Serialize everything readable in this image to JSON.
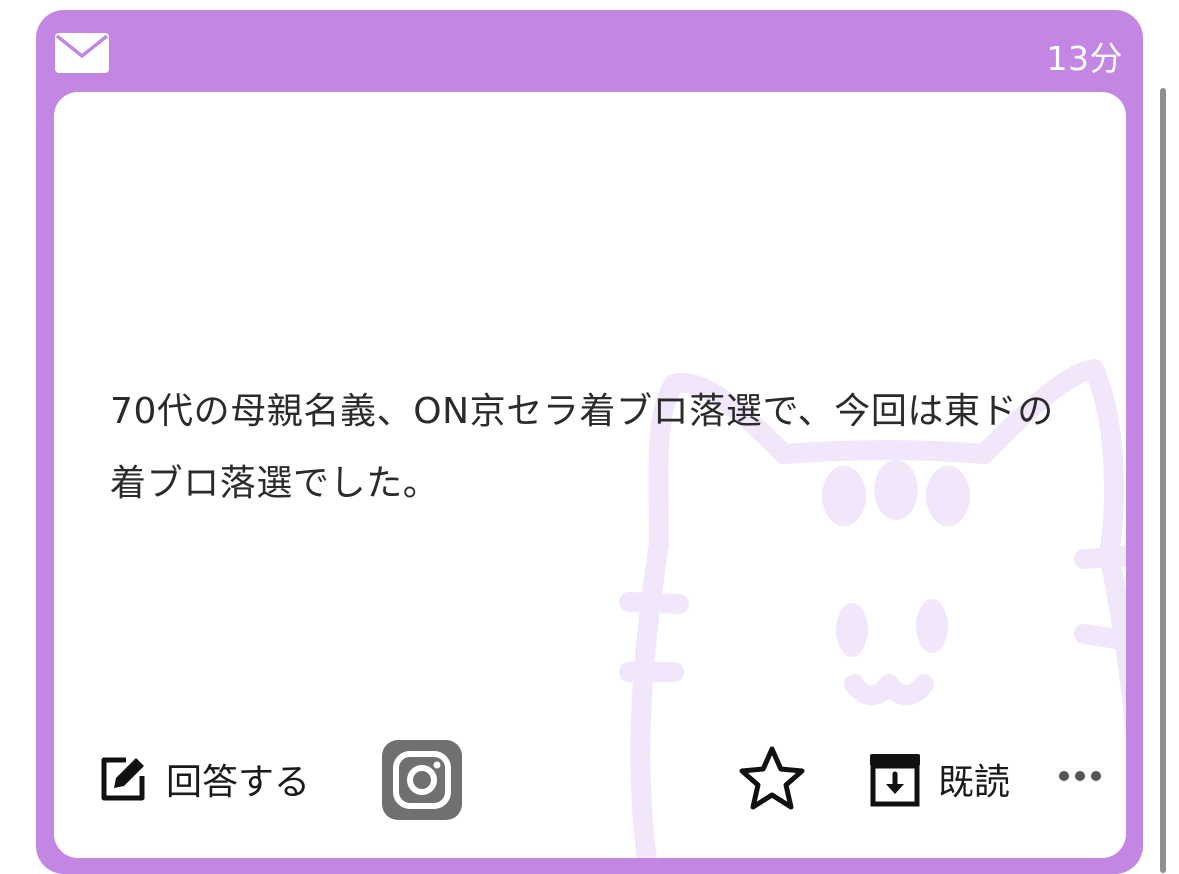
{
  "header": {
    "icon": "mail-icon",
    "time": "13分"
  },
  "message": {
    "text": "70代の母親名義、ON京セラ着ブロ落選で、今回は東ドの着ブロ落選でした。"
  },
  "actions": {
    "answer_label": "回答する",
    "answer_icon": "edit-icon",
    "instagram_icon": "instagram-icon",
    "favorite_icon": "star-icon",
    "read_label": "既読",
    "read_icon": "archive-icon",
    "more_icon": "more-icon"
  },
  "colors": {
    "card": "#c387e3",
    "cat_watermark": "#f2e6fb",
    "text": "#2b2b2b",
    "instagram_bg": "#707070"
  }
}
